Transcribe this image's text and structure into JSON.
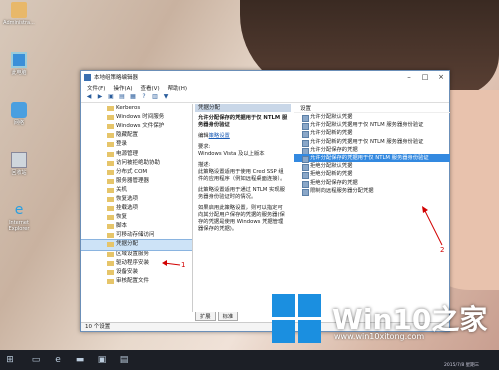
{
  "desktop": {
    "icons": [
      {
        "label": "Administra..."
      },
      {
        "label": "此电脑"
      },
      {
        "label": "网络"
      },
      {
        "label": "回收站"
      },
      {
        "label": "Internet Explorer"
      }
    ]
  },
  "window": {
    "title": "本地组策略编辑器",
    "menu": [
      "文件(F)",
      "操作(A)",
      "查看(V)",
      "帮助(H)"
    ],
    "tree": [
      "Kerberos",
      "Windows 时间服务",
      "Windows 文件保护",
      "隐藏配置",
      "登录",
      "电源管理",
      "访问被拒绝助协助",
      "分布式 COM",
      "服务器管理器",
      "关机",
      "恢复选项",
      "挂载选项",
      "恢复",
      "脚本",
      "可移动存储访问",
      "凭据分配",
      "区域设置服务",
      "驱动程序安装",
      "设备安装",
      "审核配置文件"
    ],
    "middle": {
      "header": "凭据分配",
      "title": "允许分配保存的凭据用于仅 NTLM 服务器身份验证",
      "edit_prefix": "编辑",
      "edit_link": "策略设置",
      "req_label": "要求:",
      "req_value": "Windows Vista 及以上版本",
      "desc_label": "描述:",
      "desc1": "此策略设置适用于使用 Cred SSP 组件的应用程序（例如远程桌面连接）。",
      "desc2": "此策略设置适用于通过 NTLM 实现服务器身份验证时的情况。",
      "desc3": "如果启用此策略设置，则可以指定可向其分配用户保存的凭据的服务器(保存的凭据是使用 Windows 凭据管理器保存的凭据)。"
    },
    "right": {
      "header": "设置",
      "items": [
        "允许分配默认凭据",
        "允许分配默认凭据用于仅 NTLM 服务器身份验证",
        "允许分配新的凭据",
        "允许分配新的凭据用于仅 NTLM 服务器身份验证",
        "允许分配保存的凭据",
        "允许分配保存的凭据用于仅 NTLM 服务器身份验证",
        "拒绝分配默认凭据",
        "拒绝分配新的凭据",
        "拒绝分配保存的凭据",
        "限制向远程服务器分配凭据"
      ],
      "selected_index": 5
    },
    "tabs": [
      "扩展",
      "标准"
    ],
    "status": "10 个设置"
  },
  "annotations": {
    "n1": "1",
    "n2": "2"
  },
  "logo": {
    "brand": "Win10之家",
    "url": "www.win10xitong.com"
  },
  "taskbar": {
    "clock": "2015/7/8 星期三"
  }
}
